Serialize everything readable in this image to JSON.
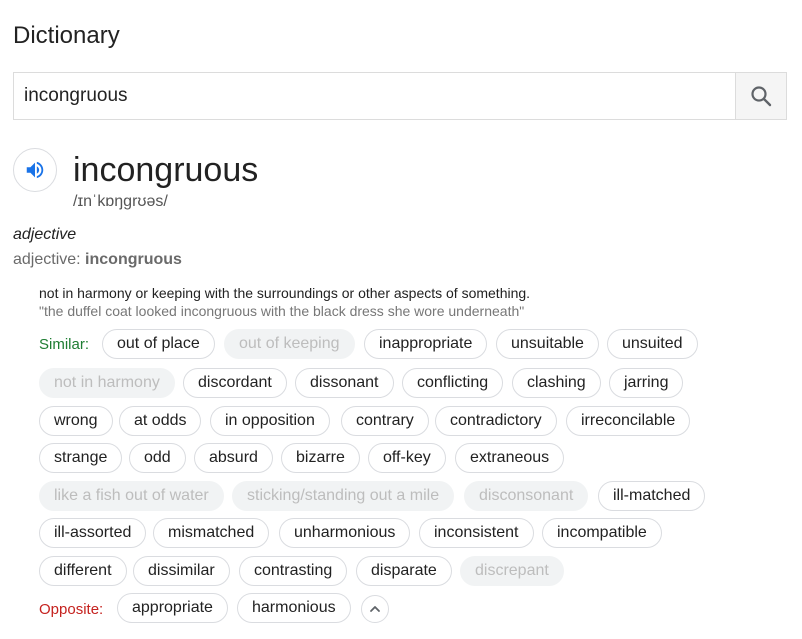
{
  "header": {
    "title": "Dictionary"
  },
  "search": {
    "value": "incongruous",
    "icon": "search-icon"
  },
  "entry": {
    "word": "incongruous",
    "phonetic": "/ɪnˈkɒŋɡrʊəs/",
    "part_of_speech": "adjective",
    "pos_prefix": "adjective: ",
    "pos_word": "incongruous",
    "definition": "not in harmony or keeping with the surroundings or other aspects of something.",
    "example": "\"the duffel coat looked incongruous with the black dress she wore underneath\""
  },
  "similar": {
    "label": "Similar:",
    "chips": [
      {
        "text": "out of place",
        "dim": false
      },
      {
        "text": "out of keeping",
        "dim": true
      },
      {
        "text": "inappropriate",
        "dim": false
      },
      {
        "text": "unsuitable",
        "dim": false
      },
      {
        "text": "unsuited",
        "dim": false
      },
      {
        "text": "not in harmony",
        "dim": true
      },
      {
        "text": "discordant",
        "dim": false
      },
      {
        "text": "dissonant",
        "dim": false
      },
      {
        "text": "conflicting",
        "dim": false
      },
      {
        "text": "clashing",
        "dim": false
      },
      {
        "text": "jarring",
        "dim": false
      },
      {
        "text": "wrong",
        "dim": false
      },
      {
        "text": "at odds",
        "dim": false
      },
      {
        "text": "in opposition",
        "dim": false
      },
      {
        "text": "contrary",
        "dim": false
      },
      {
        "text": "contradictory",
        "dim": false
      },
      {
        "text": "irreconcilable",
        "dim": false
      },
      {
        "text": "strange",
        "dim": false
      },
      {
        "text": "odd",
        "dim": false
      },
      {
        "text": "absurd",
        "dim": false
      },
      {
        "text": "bizarre",
        "dim": false
      },
      {
        "text": "off-key",
        "dim": false
      },
      {
        "text": "extraneous",
        "dim": false
      },
      {
        "text": "like a fish out of water",
        "dim": true
      },
      {
        "text": "sticking/standing out a mile",
        "dim": true
      },
      {
        "text": "disconsonant",
        "dim": true
      },
      {
        "text": "ill-matched",
        "dim": false
      },
      {
        "text": "ill-assorted",
        "dim": false
      },
      {
        "text": "mismatched",
        "dim": false
      },
      {
        "text": "unharmonious",
        "dim": false
      },
      {
        "text": "inconsistent",
        "dim": false
      },
      {
        "text": "incompatible",
        "dim": false
      },
      {
        "text": "different",
        "dim": false
      },
      {
        "text": "dissimilar",
        "dim": false
      },
      {
        "text": "contrasting",
        "dim": false
      },
      {
        "text": "disparate",
        "dim": false
      },
      {
        "text": "discrepant",
        "dim": true
      }
    ]
  },
  "opposite": {
    "label": "Opposite:",
    "chips": [
      {
        "text": "appropriate",
        "dim": false
      },
      {
        "text": "harmonious",
        "dim": false
      }
    ]
  },
  "colors": {
    "similar_label": "#1e7d32",
    "opposite_label": "#c5221f",
    "speaker": "#1a73e8"
  }
}
